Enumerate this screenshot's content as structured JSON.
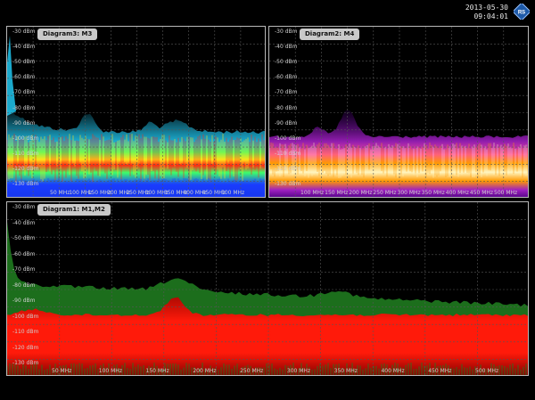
{
  "header": {
    "date": "2013-05-30",
    "time": "09:04:01",
    "logo_icon": "rohde-schwarz-logo"
  },
  "panels": {
    "diagram3": {
      "title": "Diagram3: M3",
      "y_labels": [
        "-30 dBm",
        "-40 dBm",
        "-50 dBm",
        "-60 dBm",
        "-70 dBm",
        "-80 dBm",
        "-90 dBm",
        "-100 dBm",
        "-110 dBm",
        "-120 dBm",
        "-130 dBm"
      ],
      "x_labels": [
        "50 MHz",
        "100 MHz",
        "150 MHz",
        "200 MHz",
        "250 MHz",
        "300 MHz",
        "350 MHz",
        "400 MHz",
        "450 MHz",
        "500 MHz"
      ]
    },
    "diagram2": {
      "title": "Diagram2: M4",
      "y_labels": [
        "-30 dBm",
        "-40 dBm",
        "-50 dBm",
        "-60 dBm",
        "-70 dBm",
        "-80 dBm",
        "-90 dBm",
        "-100 dBm",
        "-110 dBm",
        "-120 dBm",
        "-130 dBm"
      ],
      "x_labels": [
        "100 MHz",
        "150 MHz",
        "200 MHz",
        "250 MHz",
        "300 MHz",
        "350 MHz",
        "400 MHz",
        "450 MHz",
        "500 MHz"
      ]
    },
    "diagram1": {
      "title": "Diagram1: M1,M2",
      "y_labels": [
        "-30 dBm",
        "-40 dBm",
        "-50 dBm",
        "-60 dBm",
        "-70 dBm",
        "-80 dBm",
        "-90 dBm",
        "-100 dBm",
        "-110 dBm",
        "-120 dBm",
        "-130 dBm"
      ],
      "x_labels": [
        "50 MHz",
        "100 MHz",
        "150 MHz",
        "200 MHz",
        "250 MHz",
        "300 MHz",
        "350 MHz",
        "400 MHz",
        "450 MHz",
        "500 MHz"
      ]
    }
  },
  "colors": {
    "panel_border": "#b9b9b9",
    "grid": "#555555",
    "persistence_cool": [
      "#1a3cff",
      "#22d3ff",
      "#3cff6a",
      "#ffe21a",
      "#ff2a12"
    ],
    "persistence_hot": [
      "#4a0080",
      "#a020c0",
      "#ff4fa0",
      "#ff9a00",
      "#fff6c0"
    ],
    "trace_max": "#1f7a1f",
    "trace_avg": "#ff1a0a"
  }
}
